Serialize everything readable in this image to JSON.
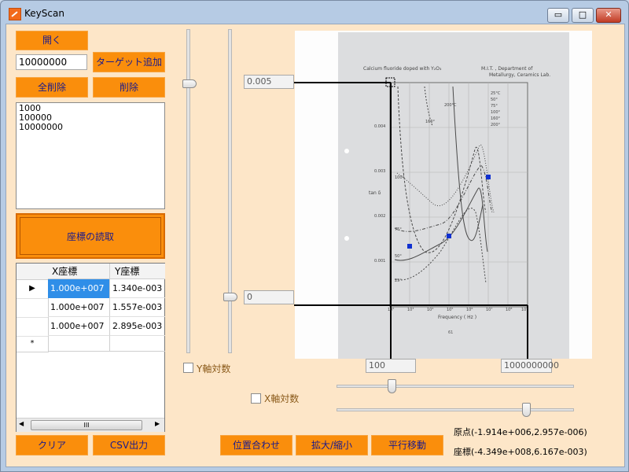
{
  "window": {
    "title": "KeyScan",
    "min_glyph": "▭",
    "max_glyph": "□",
    "close_glyph": "✕"
  },
  "buttons": {
    "open": "開く",
    "add_target": "ターゲット追加",
    "delete_all": "全削除",
    "delete": "削除",
    "read_coords": "座標の読取",
    "clear": "クリア",
    "csv": "CSV出力",
    "align": "位置合わせ",
    "zoom": "拡大/縮小",
    "pan": "平行移動"
  },
  "target_input": "10000000",
  "targets": [
    "1000",
    "100000",
    "10000000"
  ],
  "table": {
    "headers": [
      "X座標",
      "Y座標"
    ],
    "rows": [
      [
        "1.000e+007",
        "1.340e-003"
      ],
      [
        "1.000e+007",
        "1.557e-003"
      ],
      [
        "1.000e+007",
        "2.895e-003"
      ]
    ],
    "new_row_marker": "*",
    "current_row_marker": "▶",
    "scroll_left": "◀",
    "scroll_right": "▶",
    "scroll_grip": "III"
  },
  "calibration": {
    "y_max": "0.005",
    "y_min": "0",
    "x_min": "100",
    "x_max": "1000000000"
  },
  "checkboxes": {
    "y_log": "Y軸対数",
    "x_log": "X軸対数"
  },
  "status": {
    "origin": "原点(-1.914e+006,2.957e-006)",
    "coords": "座標(-4.349e+008,6.167e-003)"
  },
  "image": {
    "title_left": "Calcium fluoride doped with Y₂O₃",
    "title_right_1": "M.I.T. ,  Department of",
    "title_right_2": "Metallurgy, Ceramics Lab.",
    "ylabel": "tan δ",
    "xlabel": "Frequency ( Hz )",
    "yticks": [
      "0.004",
      "0.003",
      "0.002",
      "0.001"
    ],
    "xticks": [
      "10²",
      "10³",
      "10⁴",
      "10⁵",
      "10⁶",
      "10⁷",
      "10⁸",
      "10⁹"
    ],
    "legend": [
      "25°C",
      "50°",
      "75°",
      "100°",
      "160°",
      "200°"
    ],
    "curve_labels": [
      "200°C",
      "160°",
      "100°",
      "75°",
      "50°",
      "25°"
    ],
    "page_note": "61"
  },
  "colors": {
    "accent": "#fa8e0c",
    "label_text": "#1a1a8c",
    "marker": "#1030d0"
  }
}
